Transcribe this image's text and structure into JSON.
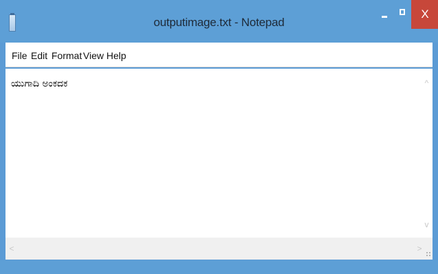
{
  "window": {
    "title": "outputimage.txt - Notepad",
    "close_label": "X"
  },
  "menu": {
    "items": [
      "File",
      "Edit",
      "Format",
      "View",
      "Help"
    ]
  },
  "editor": {
    "content": "ಯುಗಾದಿ ಅಂಕದಕ"
  },
  "scrollbars": {
    "up": "^",
    "down": "v",
    "left": "<",
    "right": ">"
  },
  "colors": {
    "title_bar": "#5d9fd6",
    "close_button": "#c7473a",
    "editor_bg": "#ffffff"
  },
  "icons": {
    "app": "notepad-icon",
    "minimize": "minimize-icon",
    "maximize": "maximize-icon",
    "close": "close-icon",
    "resize": "resize-grip-icon"
  }
}
